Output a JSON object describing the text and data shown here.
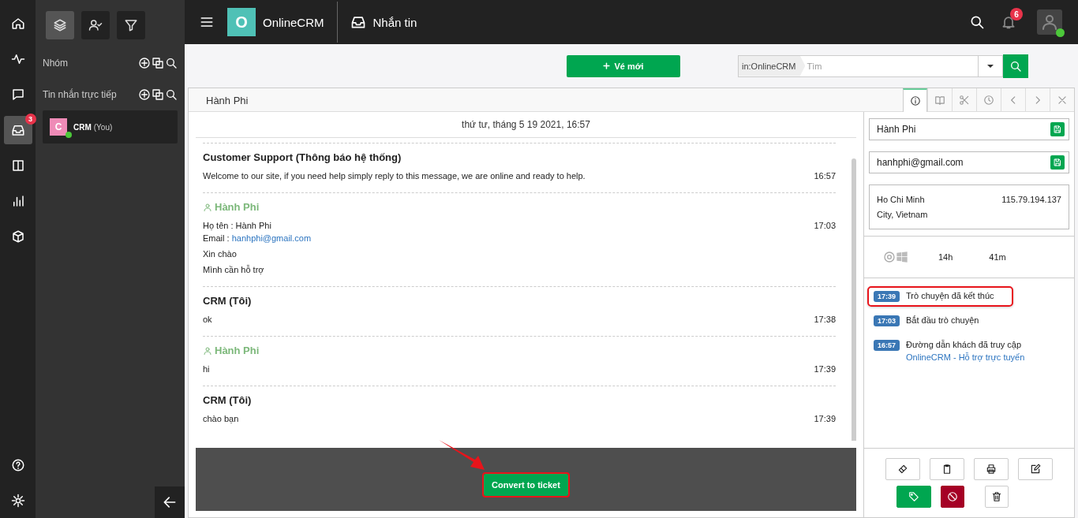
{
  "rail": {
    "items": [
      {
        "kind": "home",
        "selected": false
      },
      {
        "kind": "activity",
        "selected": false
      },
      {
        "kind": "chat",
        "selected": false
      },
      {
        "kind": "inbox",
        "selected": true,
        "badge": "3"
      },
      {
        "kind": "columns",
        "selected": false
      },
      {
        "kind": "chart",
        "selected": false
      },
      {
        "kind": "box",
        "selected": false
      }
    ],
    "bottom": [
      {
        "kind": "help",
        "selected": false
      },
      {
        "kind": "settings",
        "selected": false
      }
    ]
  },
  "sidebar": {
    "tabs": [
      {
        "kind": "layers",
        "selected": true
      },
      {
        "kind": "user-check",
        "selected": false
      },
      {
        "kind": "filter",
        "selected": false
      }
    ],
    "sections": [
      {
        "title": "Nhóm"
      },
      {
        "title": "Tin nhắn trực tiếp",
        "contacts": [
          {
            "initial": "C",
            "name": "CRM",
            "suffix": "(You)",
            "online": true,
            "selected": true
          }
        ]
      }
    ]
  },
  "topbar": {
    "logo_letter": "O",
    "app_name": "OnlineCRM",
    "section": "Nhắn tin",
    "notification_count": "6",
    "user_online": true
  },
  "toolbar": {
    "new_button": "Vé mới",
    "search_scope": "in:OnlineCRM",
    "search": {
      "placeholder": "Tìm"
    }
  },
  "conversation": {
    "tab": "Hành Phi",
    "date": "thứ tư, tháng 5 19 2021, 16:57",
    "messages": [
      {
        "kind": "system",
        "sender": "Customer Support (Thông báo hệ thống)",
        "time": "16:57",
        "lines": [
          {
            "text": "Welcome to our site, if you need help simply reply to this message, we are online and ready to help."
          }
        ]
      },
      {
        "kind": "visitor",
        "sender": "Hành Phi",
        "time": "17:03",
        "lines": [
          {
            "text": "Họ tên : Hành Phi"
          },
          {
            "text": "Email : ",
            "link": "hanhphi@gmail.com"
          }
        ],
        "notes": [
          "Xin chào",
          "Mình cần hỗ trợ"
        ]
      },
      {
        "kind": "agent",
        "sender": "CRM (Tôi)",
        "time": "17:38",
        "lines": [
          {
            "text": "ok"
          }
        ]
      },
      {
        "kind": "visitor",
        "sender": "Hành Phi",
        "time": "17:39",
        "lines": [
          {
            "text": "hi"
          }
        ]
      },
      {
        "kind": "agent",
        "sender": "CRM (Tôi)",
        "time": "17:39",
        "lines": [
          {
            "text": "chào bạn"
          }
        ]
      }
    ],
    "convert_button": {
      "label": "Convert to ticket",
      "highlighted": true,
      "pointer_arrow": true
    }
  },
  "details": {
    "tabs": [
      {
        "kind": "info",
        "selected": true
      },
      {
        "kind": "book",
        "selected": false
      },
      {
        "kind": "scissors",
        "selected": false
      },
      {
        "kind": "clock",
        "selected": false
      },
      {
        "kind": "chevron-left",
        "selected": false
      },
      {
        "kind": "chevron-right",
        "selected": false
      },
      {
        "kind": "close",
        "selected": false
      }
    ],
    "name": "Hành Phi",
    "email": "hanhphi@gmail.com",
    "location": "Ho Chi Minh City, Vietnam",
    "ip": "115.79.194.137",
    "hours": "14h",
    "minutes": "41m",
    "timeline": [
      {
        "time": "17:39",
        "text": "Trò chuyện đã kết thúc",
        "highlighted": true
      },
      {
        "time": "17:03",
        "text": "Bắt đầu trò chuyện",
        "highlighted": false
      },
      {
        "time": "16:57",
        "text": "Đường dẫn khách đã truy cập",
        "link": "OnlineCRM - Hỗ trợ trực tuyến",
        "highlighted": false
      }
    ],
    "actions": [
      {
        "kind": "ticket"
      },
      {
        "kind": "clipboard"
      },
      {
        "kind": "printer"
      },
      {
        "kind": "edit"
      },
      {
        "kind": "tag"
      },
      {
        "kind": "ban"
      },
      {
        "kind": "trash"
      }
    ]
  }
}
